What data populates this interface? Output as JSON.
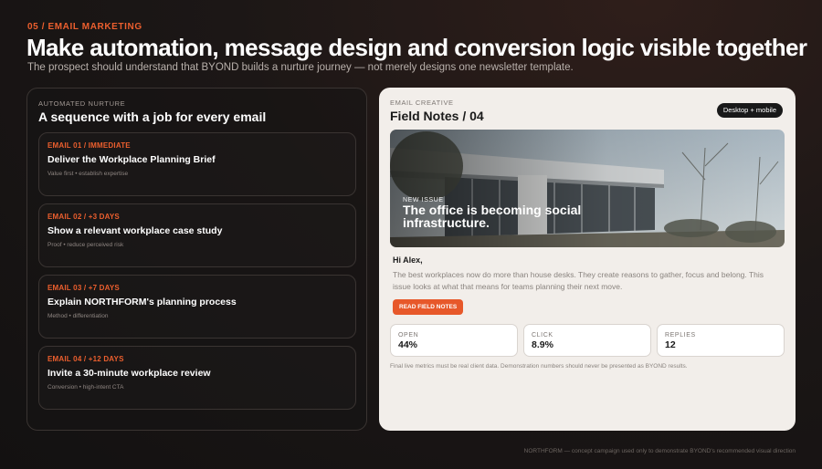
{
  "header": {
    "eyebrow": "05 / EMAIL MARKETING",
    "title": "Make automation, message design and conversion logic visible together",
    "subtitle": "The prospect should understand that BYOND builds a nurture journey — not merely designs one newsletter template."
  },
  "sequence": {
    "eyebrow": "AUTOMATED NURTURE",
    "title": "A sequence with a job for every email",
    "emails": [
      {
        "label": "EMAIL 01 / IMMEDIATE",
        "title": "Deliver the Workplace Planning Brief",
        "meta": "Value first • establish expertise"
      },
      {
        "label": "EMAIL 02 / +3 DAYS",
        "title": "Show a relevant workplace case study",
        "meta": "Proof • reduce perceived risk"
      },
      {
        "label": "EMAIL 03 / +7 DAYS",
        "title": "Explain NORTHFORM's planning process",
        "meta": "Method • differentiation"
      },
      {
        "label": "EMAIL 04 / +12 DAYS",
        "title": "Invite a 30-minute workplace review",
        "meta": "Conversion • high-intent CTA"
      }
    ]
  },
  "creative": {
    "eyebrow": "EMAIL CREATIVE",
    "title": "Field Notes / 04",
    "pill": "Desktop + mobile",
    "hero_eyebrow": "NEW ISSUE",
    "hero_title": "The office is becoming social infrastructure.",
    "greeting": "Hi Alex,",
    "body": "The best workplaces now do more than house desks. They create reasons to gather, focus and belong. This issue looks at what that means for teams planning their next move.",
    "cta": "READ FIELD NOTES",
    "metrics": [
      {
        "label": "OPEN",
        "value": "44%"
      },
      {
        "label": "CLICK",
        "value": "8.9%"
      },
      {
        "label": "REPLIES",
        "value": "12"
      }
    ],
    "footnote": "Final live metrics must be real client data. Demonstration numbers should never be presented as BYOND results."
  },
  "footer": "NORTHFORM — concept campaign used only to demonstrate BYOND's recommended visual direction",
  "colors": {
    "accent": "#ec5f2e",
    "panel_light": "#f2eeea",
    "background": "#161313"
  }
}
